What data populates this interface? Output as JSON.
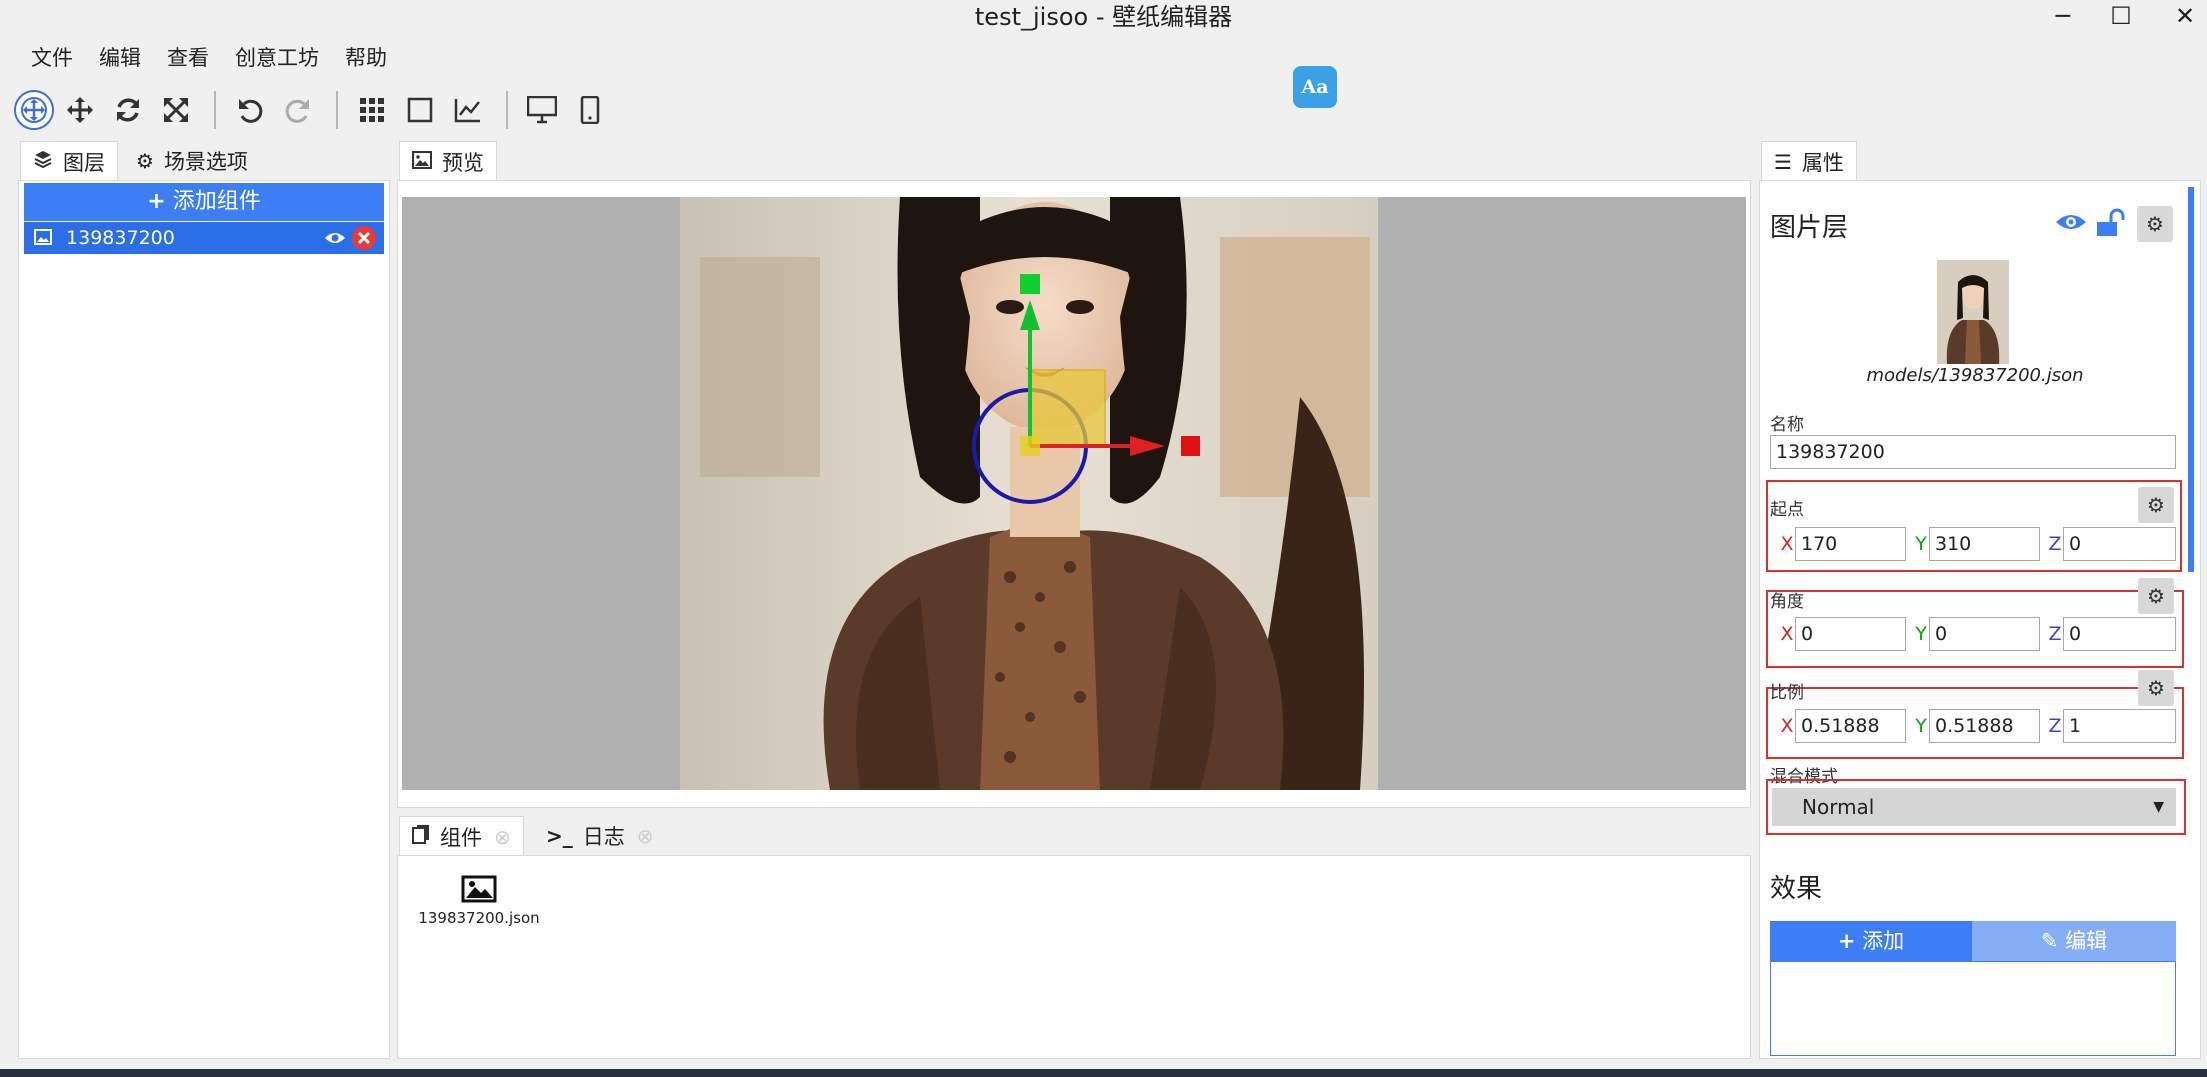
{
  "window": {
    "title": "test_jisoo - 壁纸编辑器",
    "minimize_icon": "─",
    "maximize_icon": "☐",
    "close_icon": "✕"
  },
  "menu": [
    "文件",
    "编辑",
    "查看",
    "创意工坊",
    "帮助"
  ],
  "toolbar": {
    "font_badge": "Aa",
    "icons": [
      "gizmo-select-icon",
      "move-icon",
      "rotate-icon",
      "scale-icon",
      "undo-icon",
      "redo-icon",
      "grid-icon",
      "square-icon",
      "chart-icon",
      "desktop-icon",
      "phone-icon"
    ]
  },
  "left_panel": {
    "tabs": [
      {
        "label": "图层",
        "icon": "layers-icon"
      },
      {
        "label": "场景选项",
        "icon": "gear-icon"
      }
    ],
    "add_component_label": "添加组件",
    "layers": [
      {
        "name": "139837200"
      }
    ]
  },
  "preview": {
    "tab_label": "预览"
  },
  "bottom_panel": {
    "tabs": [
      {
        "label": "组件",
        "icon": "files-icon"
      },
      {
        "label": "日志",
        "icon": "terminal-icon"
      }
    ],
    "files": [
      {
        "name": "139837200.json"
      }
    ]
  },
  "properties": {
    "tab_label": "属性",
    "layer_type": "图片层",
    "model_path": "models/139837200.json",
    "name_label": "名称",
    "name_value": "139837200",
    "origin": {
      "label": "起点",
      "x": "170",
      "y": "310",
      "z": "0"
    },
    "angle": {
      "label": "角度",
      "x": "0",
      "y": "0",
      "z": "0"
    },
    "scale": {
      "label": "比例",
      "x": "0.51888",
      "y": "0.51888",
      "z": "1"
    },
    "blend": {
      "label": "混合模式",
      "value": "Normal"
    },
    "effects": {
      "label": "效果",
      "add_label": "添加",
      "edit_label": "编辑"
    },
    "axes": {
      "x": "X",
      "y": "Y",
      "z": "Z"
    }
  },
  "colors": {
    "accent": "#3d7ef5",
    "axis_x": "#e02020",
    "axis_y": "#10a010",
    "axis_z": "#4040d0",
    "highlight_box": "#d83030"
  }
}
